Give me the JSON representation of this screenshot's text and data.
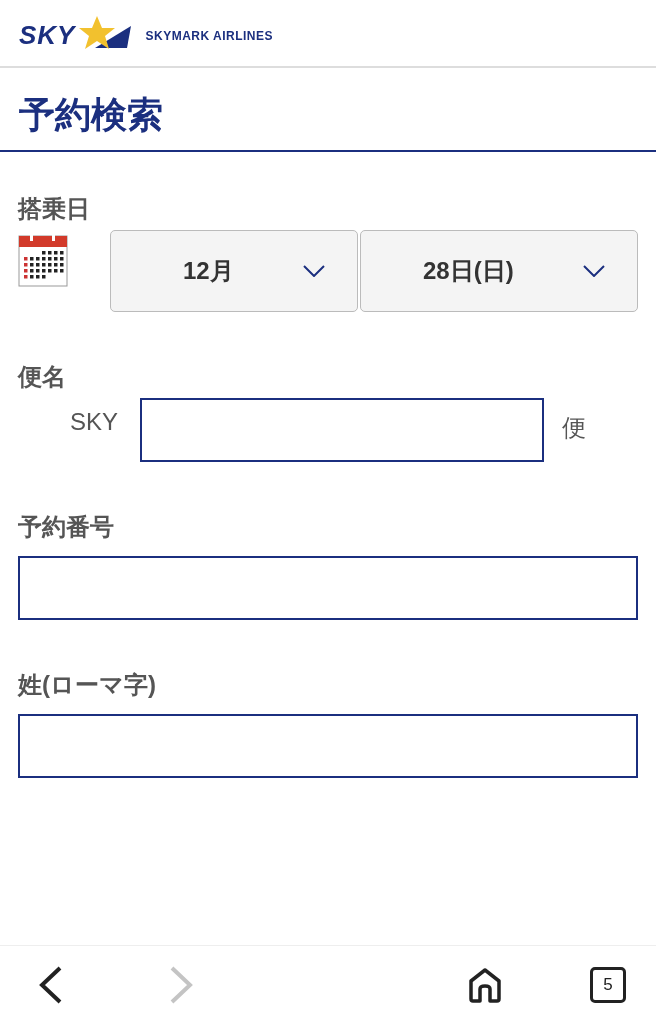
{
  "header": {
    "logo_text": "SKY",
    "brand_name": "SKYMARK AIRLINES"
  },
  "page_title": "予約検索",
  "boarding_date": {
    "label": "搭乗日",
    "month": "12月",
    "day": "28日(日)"
  },
  "flight_number": {
    "label": "便名",
    "prefix": "SKY",
    "suffix": "便"
  },
  "fields": [
    {
      "label": "予約番号"
    },
    {
      "label": "姓(ローマ字)"
    }
  ],
  "browser_bar": {
    "back_disabled": false,
    "forward_disabled": true,
    "tab_count": "5"
  }
}
